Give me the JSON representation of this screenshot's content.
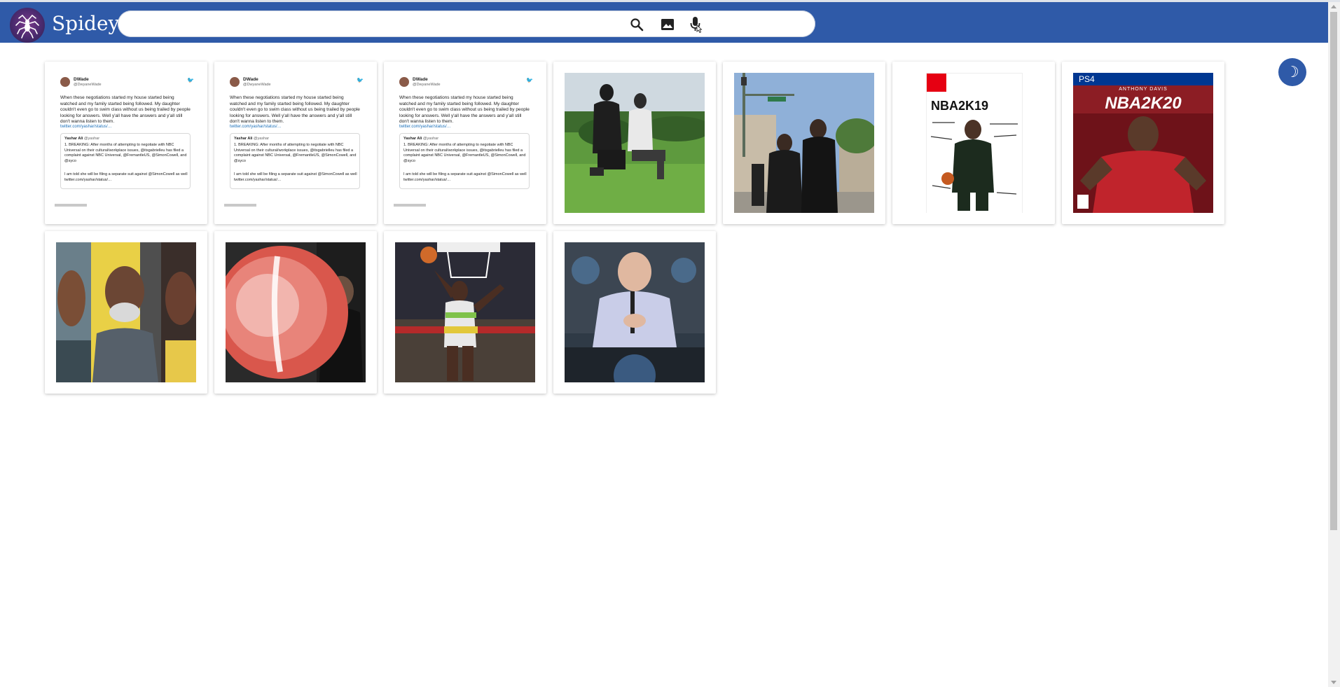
{
  "app": {
    "name": "Spidey"
  },
  "search": {
    "value": "",
    "placeholder": ""
  },
  "theme_toggle": {
    "glyph": "☽"
  },
  "colors": {
    "header": "#2f5aa8",
    "accent": "#2f5aa8"
  },
  "tweet": {
    "name": "DWade",
    "handle": "@DwyaneWade",
    "body": "When these negotiations started my house started being watched and my family started being followed. My daughter couldn't even go to swim class without us being trailed by people looking for answers. Well y'all have the answers and y'all still don't wanna listen to them.",
    "link": "twitter.com/yashar/status/…",
    "quote_name": "Yashar Ali",
    "quote_handle": "@yashar",
    "quote_body": "1. BREAKING: After months of attempting to negotiate with NBC Universal on their cultural/workplace issues, @itsgabrielleu has filed a complaint against NBC Universal, @FremantleUS, @SimonCowell, and @syco",
    "quote_body2": "I am told she will be filing a separate suit against @SimonCowell as well twitter.com/yashar/status/…"
  },
  "results": [
    {
      "kind": "tweet",
      "desc": "tweet-screenshot"
    },
    {
      "kind": "tweet",
      "desc": "tweet-screenshot"
    },
    {
      "kind": "tweet",
      "desc": "tweet-screenshot"
    },
    {
      "kind": "photo",
      "desc": "protest-kneeling-photo"
    },
    {
      "kind": "photo",
      "desc": "street-march-photo"
    },
    {
      "kind": "cover",
      "desc": "nba2k19-cover",
      "title": "NBA2K19",
      "banner": ""
    },
    {
      "kind": "cover",
      "desc": "nba2k20-cover",
      "title": "NBA2K20",
      "banner": "PS4",
      "subtitle": "ANTHONY DAVIS"
    },
    {
      "kind": "photo",
      "desc": "players-collage-photo"
    },
    {
      "kind": "photo",
      "desc": "basketball-blur-photo"
    },
    {
      "kind": "photo",
      "desc": "dunk-photo"
    },
    {
      "kind": "photo",
      "desc": "press-conference-photo"
    }
  ]
}
